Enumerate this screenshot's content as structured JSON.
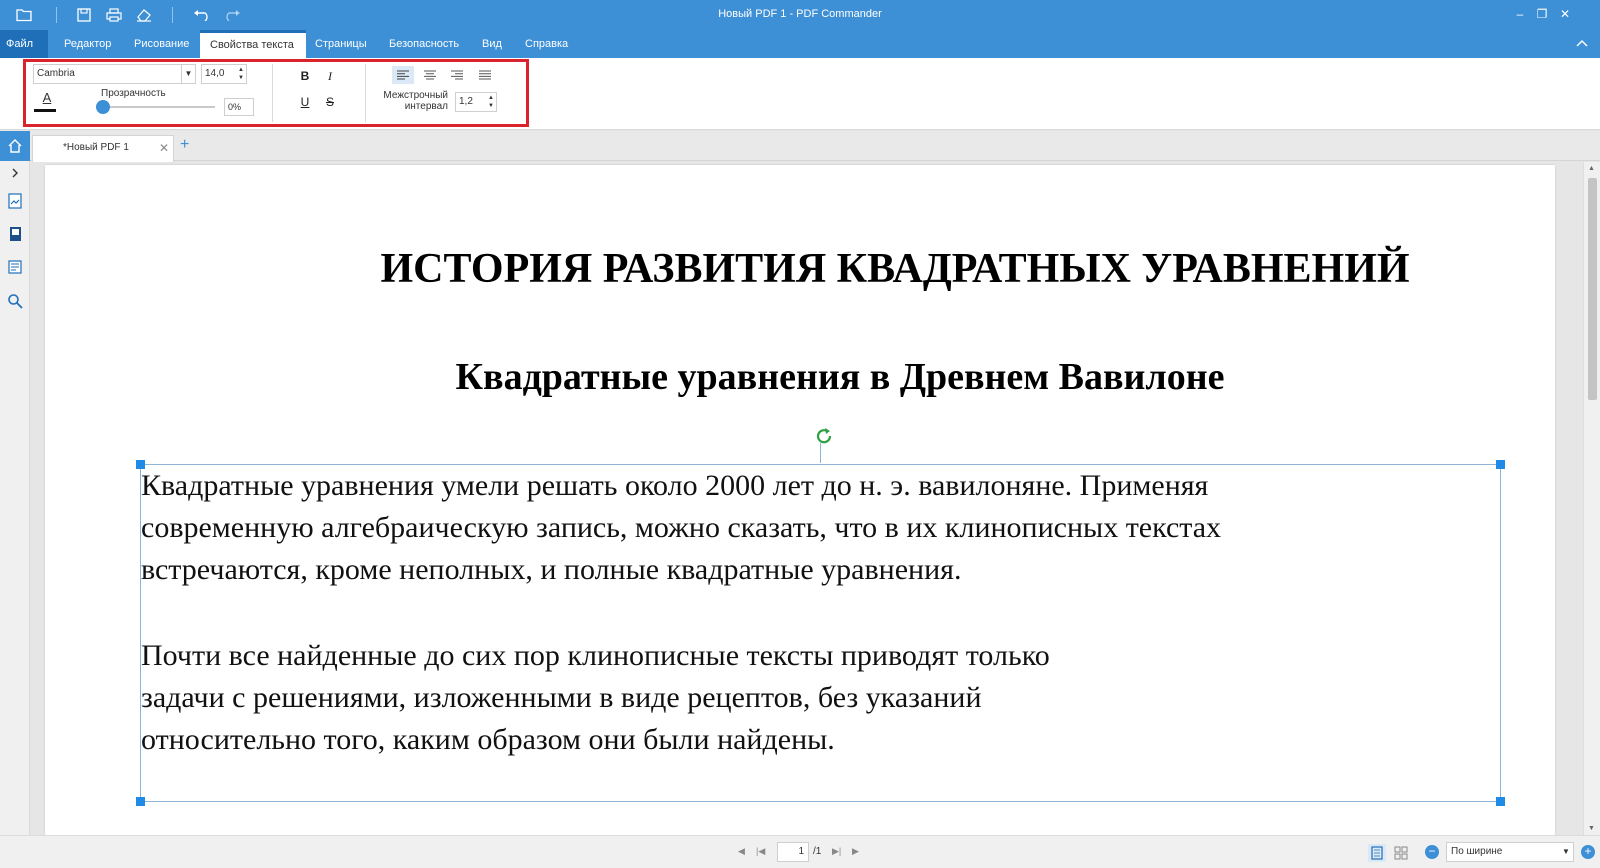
{
  "window": {
    "title": "Новый PDF 1 - PDF Commander",
    "minimize": "–",
    "maximize": "❐",
    "close": "✕"
  },
  "menu": {
    "file": "Файл",
    "items": [
      "Редактор",
      "Рисование",
      "Свойства текста",
      "Страницы",
      "Безопасность",
      "Вид",
      "Справка"
    ],
    "active_index": 2
  },
  "ribbon": {
    "font_name": "Cambria",
    "font_size": "14,0",
    "color_letter": "A",
    "text_color": "#111111",
    "opacity_label": "Прозрачность",
    "opacity_value": "0%",
    "opacity_level": 0,
    "bold": "B",
    "italic": "I",
    "underline": "U",
    "strike": "S",
    "line_spacing_label_1": "Межстрочный",
    "line_spacing_label_2": "интервал",
    "line_spacing_value": "1,2",
    "highlight_color": "#d9232d"
  },
  "tabs": {
    "doc_tab": "*Новый PDF 1",
    "close": "✕",
    "add": "+"
  },
  "document": {
    "title": "ИСТОРИЯ РАЗВИТИЯ КВАДРАТНЫХ УРАВНЕНИЙ",
    "subtitle": "Квадратные уравнения в Древнем Вавилоне",
    "para1_lines": [
      "Квадратные уравнения умели решать около 2000 лет до н. э. вавилоняне. Применяя",
      "современную алгебраическую запись, можно сказать, что в их клинописных текстах",
      "встречаются, кроме неполных, и полные квадратные уравнения."
    ],
    "para2_lines": [
      "Почти все найденные до сих пор клинописные тексты приводят только",
      "задачи с решениями, изложенными в виде рецептов, без указаний",
      "относительно того, каким образом они были найдены."
    ]
  },
  "statusbar": {
    "page_current": "1",
    "page_total": "/1",
    "zoom_mode": "По ширине",
    "zoom_out": "−",
    "zoom_in": "+"
  },
  "colors": {
    "accent": "#3d8fd6",
    "accent_dark": "#1f6fb8",
    "selection": "#1f8be6",
    "rotate": "#2ea043"
  }
}
